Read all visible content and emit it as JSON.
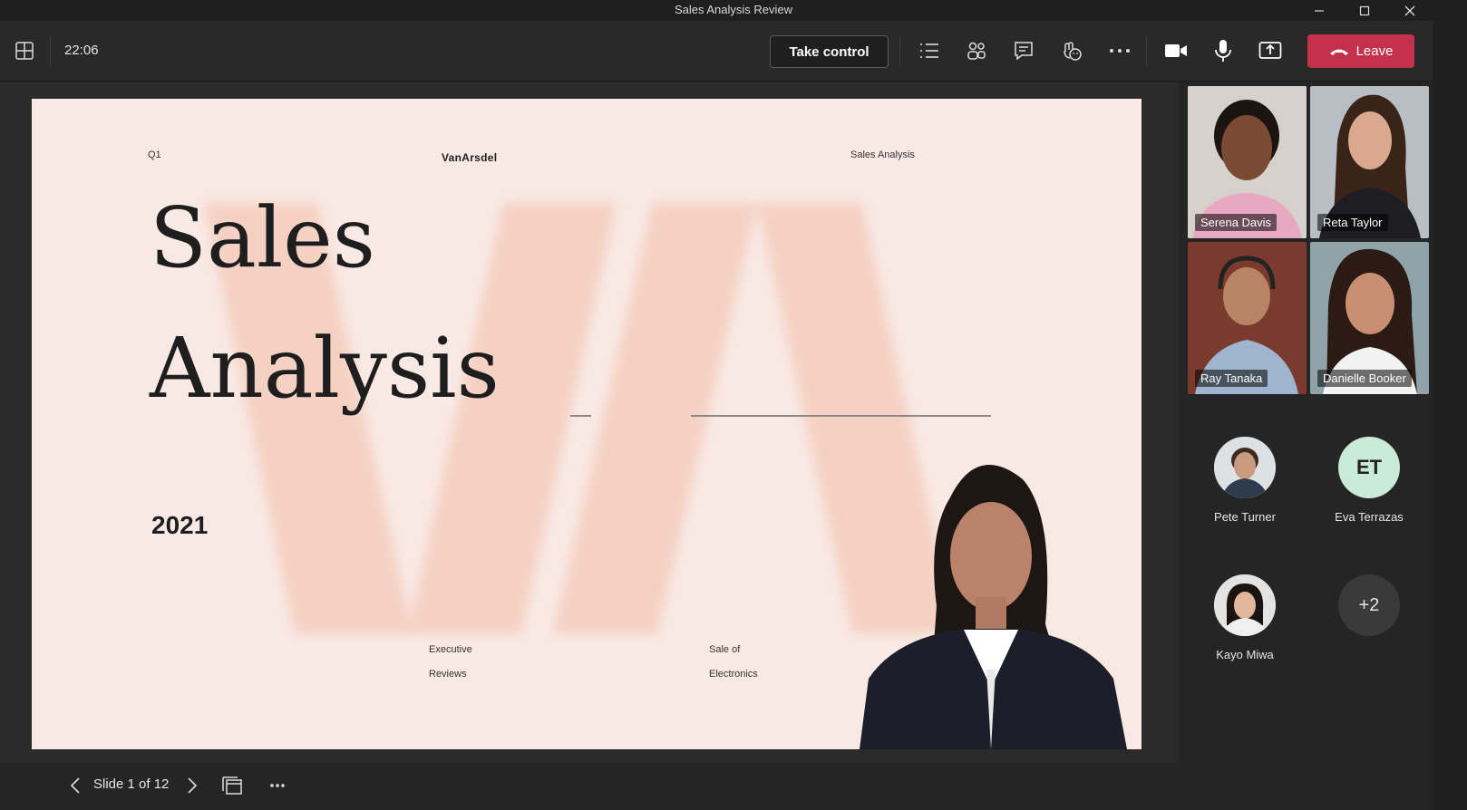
{
  "window": {
    "title": "Sales Analysis Review"
  },
  "toolbar": {
    "clock": "22:06",
    "take_control": "Take control",
    "leave": "Leave",
    "icons": [
      "grid-icon",
      "list-icon",
      "people-icon",
      "chat-icon",
      "reactions-icon",
      "more-icon",
      "camera-icon",
      "mic-icon",
      "share-icon"
    ]
  },
  "slide": {
    "q": "Q1",
    "brand": "VanArsdel",
    "header_right": "Sales Analysis",
    "title_line1": "Sales",
    "title_line2": "Analysis",
    "year": "2021",
    "footer_left_1": "Executive",
    "footer_left_2": "Reviews",
    "footer_right_1": "Sale of",
    "footer_right_2": "Electronics"
  },
  "pager": {
    "label": "Slide 1 of 12"
  },
  "participants": {
    "video": [
      {
        "name": "Serena Davis"
      },
      {
        "name": "Reta Taylor"
      },
      {
        "name": "Ray Tanaka"
      },
      {
        "name": "Danielle Booker"
      }
    ],
    "avatars": [
      {
        "name": "Pete Turner",
        "initials": ""
      },
      {
        "name": "Eva Terrazas",
        "initials": "ET"
      },
      {
        "name": "Kayo Miwa",
        "initials": ""
      }
    ],
    "overflow": "+2"
  },
  "colors": {
    "leave": "#c4314b",
    "slide_bg": "#f9e9e4",
    "accent_va": "#f4cdbd",
    "et_avatar": "#c8ead7"
  }
}
